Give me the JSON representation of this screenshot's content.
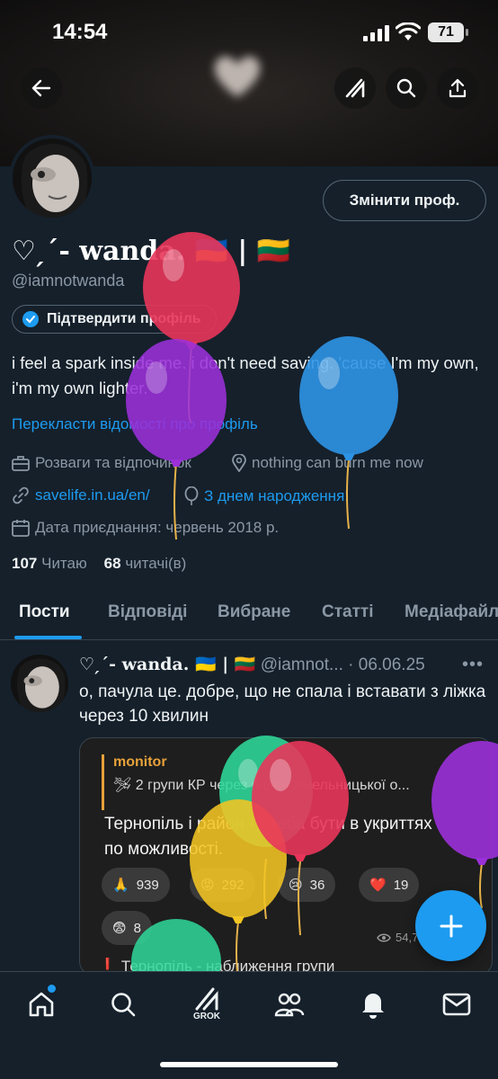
{
  "status_bar": {
    "time": "14:54",
    "battery": "71"
  },
  "header": {
    "back_icon": "arrow-left-icon",
    "grok_icon": "grok-icon",
    "search_icon": "search-icon",
    "share_icon": "share-icon"
  },
  "profile": {
    "edit_label": "Змінити проф.",
    "display_name": "♡ ̗´- wanda. 🇺🇦 | 🇱🇹",
    "handle": "@iamnotwanda",
    "verify_label": "Підтвердити профіль",
    "bio": "i feel a spark inside me. i don't need saving. 'cause I'm my own, i'm my own lighter.",
    "translate_label": "Перекласти відомості про профіль",
    "category": "Розваги та відпочинок",
    "location": "nothing can burn me now",
    "website": "savelife.in.ua/en/",
    "birthday": "З днем народження!",
    "joined": "Дата приєднання: червень 2018 р.",
    "following_count": "107",
    "following_label": "Читаю",
    "followers_count": "68",
    "followers_label": "читачі(в)"
  },
  "tabs": [
    {
      "label": "Пости",
      "active": true
    },
    {
      "label": "Відповіді"
    },
    {
      "label": "Вибране"
    },
    {
      "label": "Статті"
    },
    {
      "label": "Медіафайли"
    }
  ],
  "post": {
    "name": "♡ ̗´- wanda. 🇺🇦 | 🇱🇹",
    "handle": "@iamnot...",
    "date": "· 06.06.25",
    "text": "о, пачула це. добре, що не спала і вставати з ліжка через 10 хвилин",
    "media": {
      "source": "monitor",
      "quote": "🛩 2 групи КР через північ Хмельницької о...",
      "message": "Тернопіль і район - треба бути в укриттях по можливості.",
      "reactions": [
        {
          "emoji": "🙏",
          "count": "939"
        },
        {
          "emoji": "😡",
          "count": "292"
        },
        {
          "emoji": "😢",
          "count": "36"
        },
        {
          "emoji": "❤️",
          "count": "19"
        },
        {
          "emoji": "😨",
          "count": "8"
        }
      ],
      "views": "54,7",
      "next_line": "❗ Тернопіль - наближення групи"
    }
  },
  "bottom_nav": {
    "items": [
      "home-icon",
      "search-icon",
      "grok-icon",
      "communities-icon",
      "notifications-icon",
      "messages-icon"
    ],
    "grok_label": "GROK"
  },
  "colors": {
    "accent": "#1d9bf0",
    "background": "#15202b",
    "muted": "#8b98a5",
    "border": "#38444d"
  }
}
